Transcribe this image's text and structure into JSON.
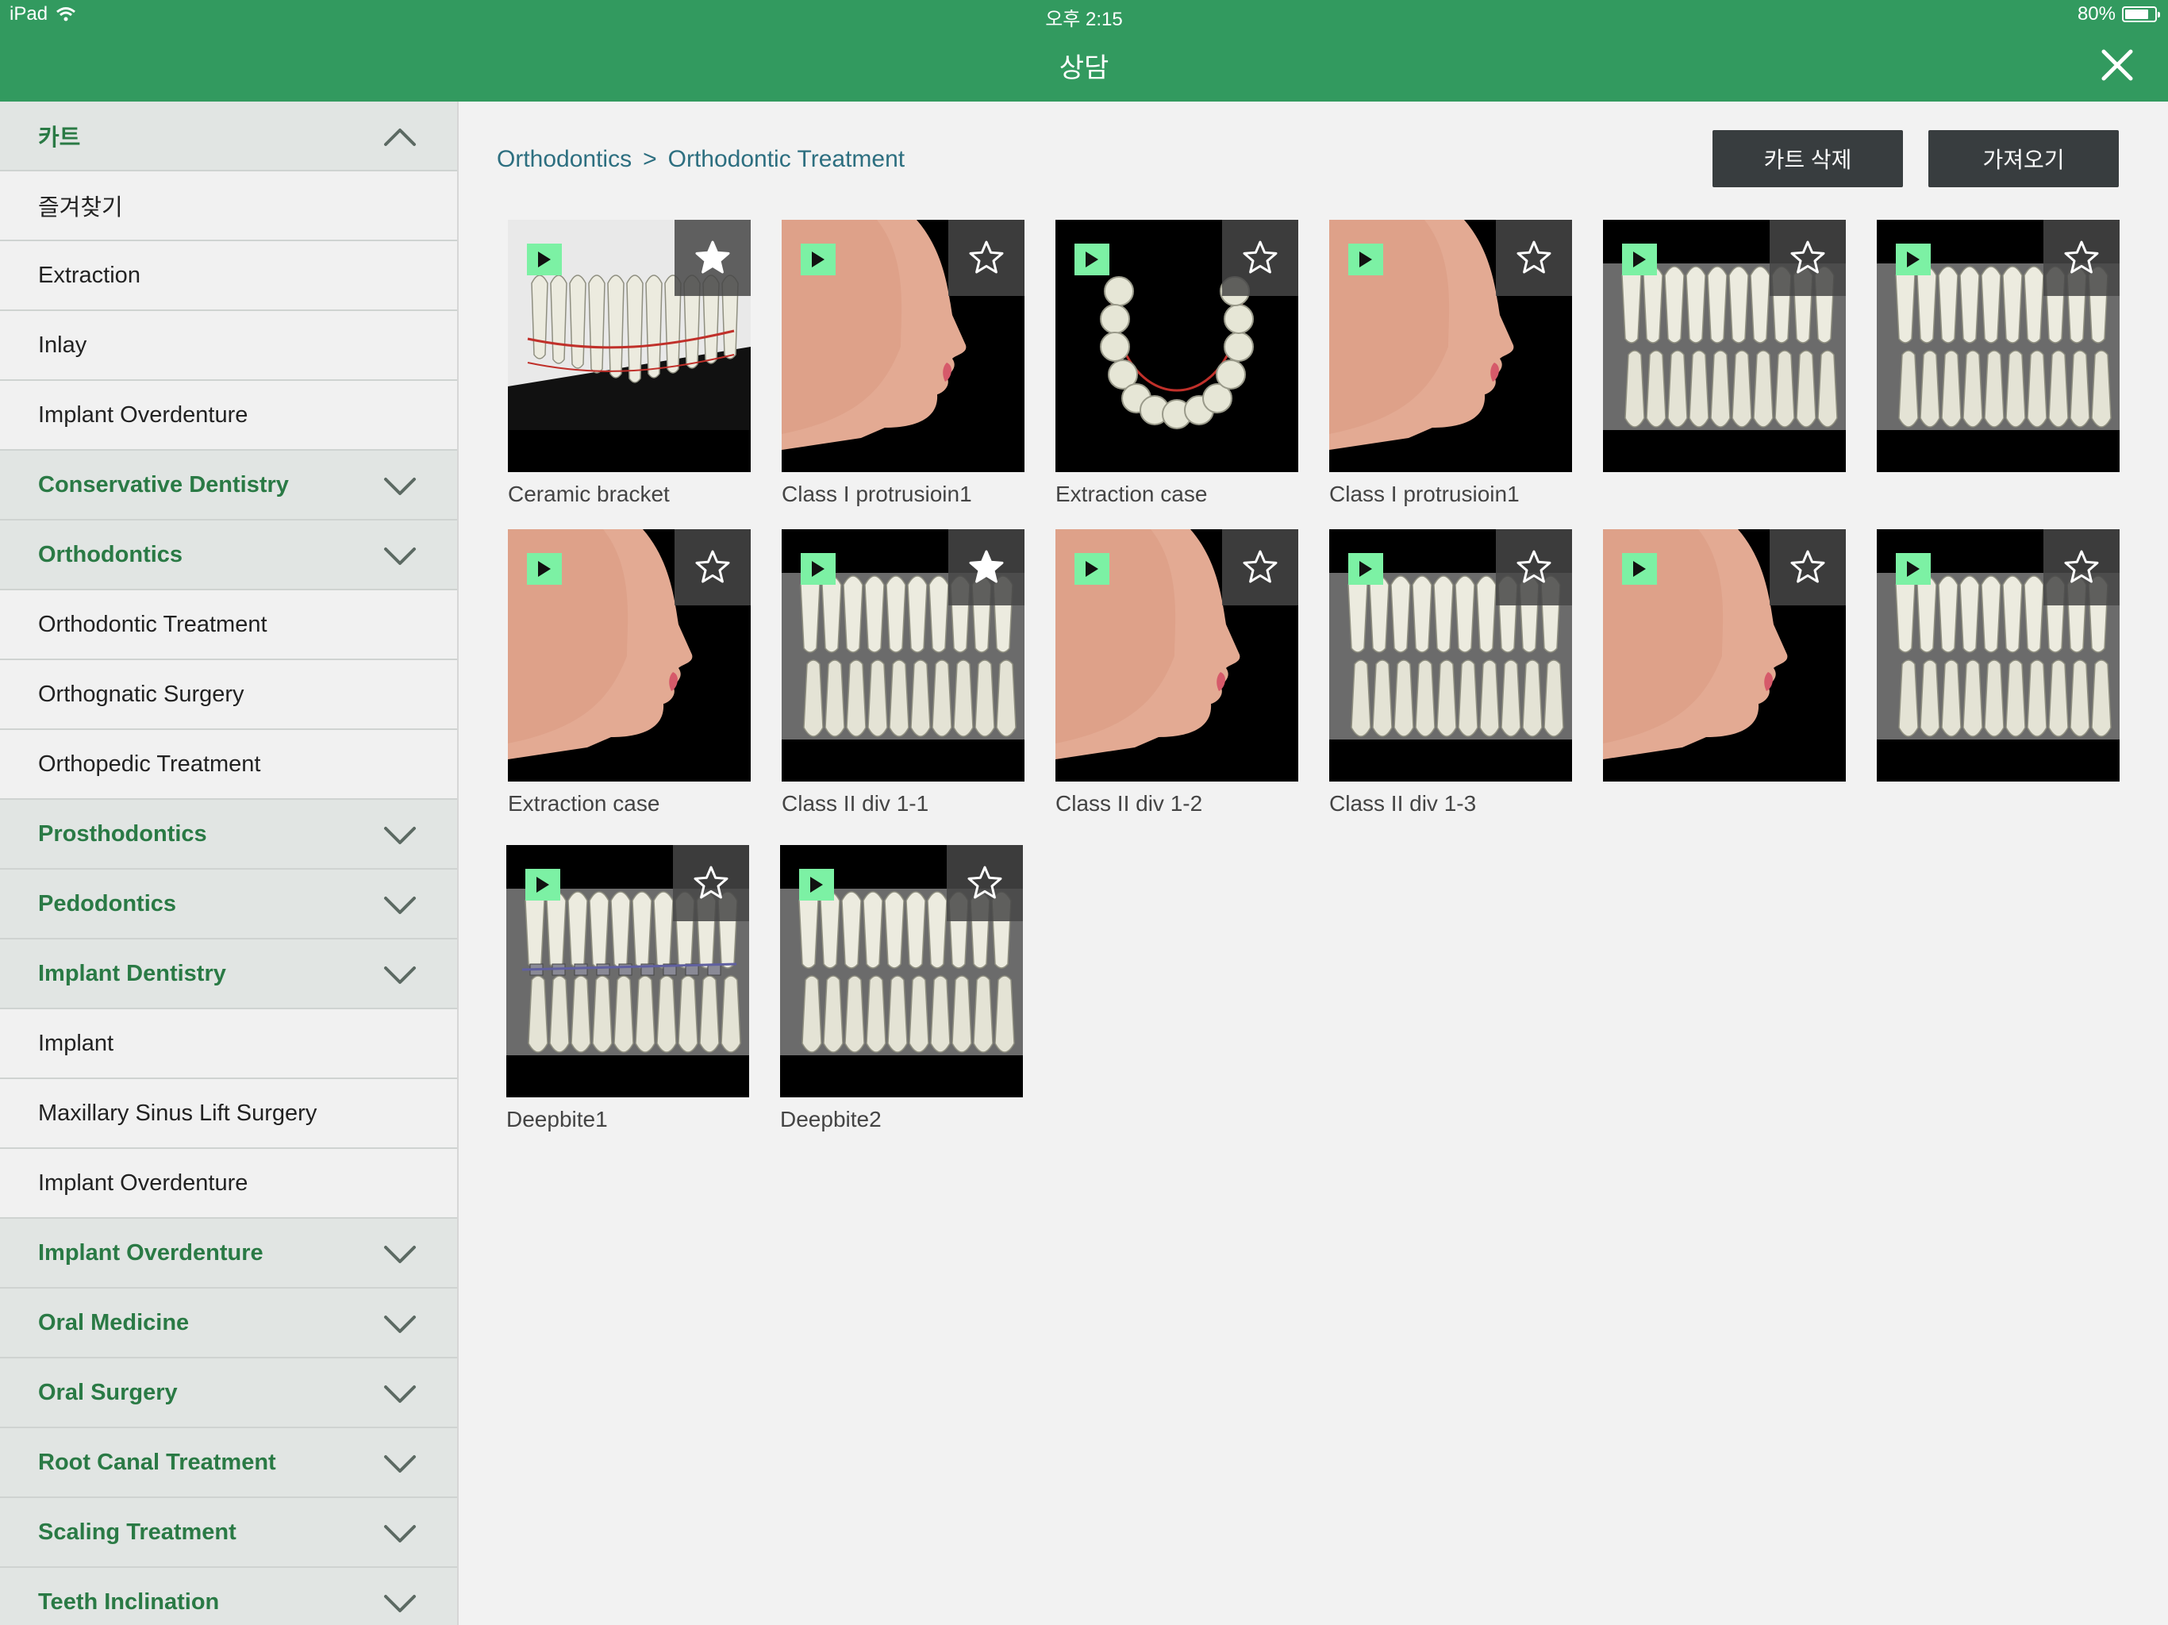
{
  "status": {
    "device": "iPad",
    "time": "오후 2:15",
    "battery": "80%",
    "battery_level": 0.8
  },
  "title": "상담",
  "sidebar": {
    "items": [
      {
        "label": "카트",
        "type": "category",
        "chevron": "up"
      },
      {
        "label": "즐겨찾기",
        "type": "item"
      },
      {
        "label": "Extraction",
        "type": "item"
      },
      {
        "label": "Inlay",
        "type": "item"
      },
      {
        "label": "Implant Overdenture",
        "type": "item"
      },
      {
        "label": "Conservative Dentistry",
        "type": "category",
        "chevron": "down"
      },
      {
        "label": "Orthodontics",
        "type": "category",
        "chevron": "down"
      },
      {
        "label": "Orthodontic Treatment",
        "type": "item"
      },
      {
        "label": "Orthognatic Surgery",
        "type": "item"
      },
      {
        "label": "Orthopedic Treatment",
        "type": "item"
      },
      {
        "label": "Prosthodontics",
        "type": "category",
        "chevron": "down"
      },
      {
        "label": "Pedodontics",
        "type": "category",
        "chevron": "down"
      },
      {
        "label": "Implant Dentistry",
        "type": "category",
        "chevron": "down"
      },
      {
        "label": "Implant",
        "type": "item"
      },
      {
        "label": "Maxillary Sinus Lift Surgery",
        "type": "item"
      },
      {
        "label": "Implant Overdenture",
        "type": "item"
      },
      {
        "label": "Implant Overdenture",
        "type": "category",
        "chevron": "down"
      },
      {
        "label": "Oral Medicine",
        "type": "category",
        "chevron": "down"
      },
      {
        "label": "Oral Surgery",
        "type": "category",
        "chevron": "down"
      },
      {
        "label": "Root Canal Treatment",
        "type": "category",
        "chevron": "down"
      },
      {
        "label": "Scaling Treatment",
        "type": "category",
        "chevron": "down"
      },
      {
        "label": "Teeth Inclination",
        "type": "category",
        "chevron": "down"
      }
    ]
  },
  "breadcrumb": {
    "parent": "Orthodontics",
    "separator": ">",
    "current": "Orthodontic Treatment"
  },
  "buttons": {
    "delete_cart": "카트 삭제",
    "import": "가져오기"
  },
  "colors": {
    "brand_green": "#329a5f",
    "category_text": "#2a7a45",
    "play_badge": "#7cf1a4",
    "breadcrumb": "#2d6f80"
  },
  "grid": [
    {
      "caption": "Ceramic bracket",
      "image": "braces-arch",
      "starred": true
    },
    {
      "caption": "Class I protrusioin1",
      "image": "face-profile",
      "starred": false
    },
    {
      "caption": "Extraction case",
      "image": "lower-arch-top",
      "starred": false
    },
    {
      "caption": "Class I protrusioin1",
      "image": "face-profile",
      "starred": false
    },
    {
      "caption": "",
      "image": "teeth-side",
      "starred": false
    },
    {
      "caption": "",
      "image": "teeth-side",
      "starred": false
    },
    {
      "caption": "Extraction case",
      "image": "face-profile",
      "starred": false
    },
    {
      "caption": "Class II div 1-1",
      "image": "teeth-side",
      "starred": true
    },
    {
      "caption": "Class II div 1-2",
      "image": "face-profile",
      "starred": false
    },
    {
      "caption": "Class II div 1-3",
      "image": "teeth-side",
      "starred": false
    },
    {
      "caption": "",
      "image": "face-profile",
      "starred": false
    },
    {
      "caption": "",
      "image": "teeth-side",
      "starred": false
    },
    {
      "caption": "Deepbite1",
      "image": "braces-side",
      "starred": false
    },
    {
      "caption": "Deepbite2",
      "image": "teeth-side",
      "starred": false
    }
  ]
}
